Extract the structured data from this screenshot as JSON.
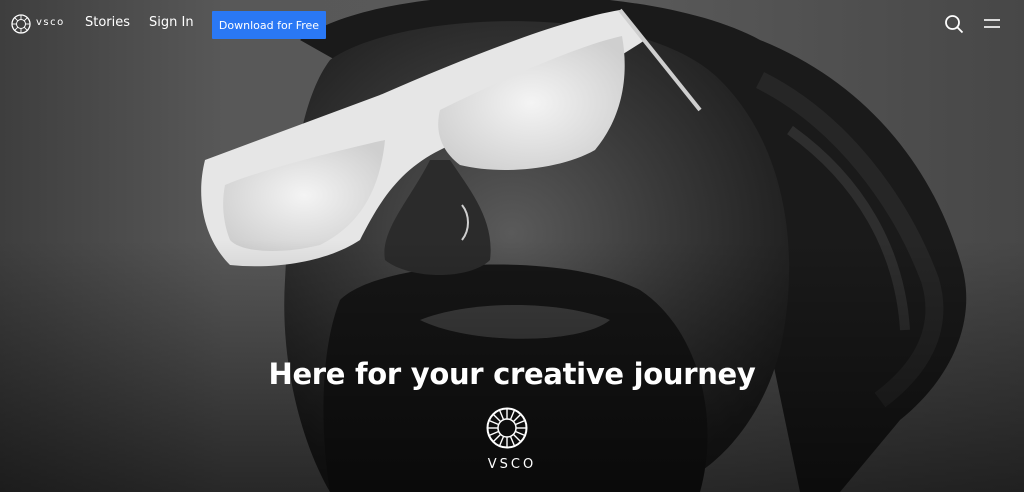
{
  "nav": {
    "brand": "vsco",
    "links": [
      "Stories",
      "Sign In"
    ],
    "download_label": "Download for Free"
  },
  "hero": {
    "headline": "Here for your creative journey",
    "brand": "VSCO"
  },
  "icons": {
    "logo": "vsco-logo-icon",
    "search": "search-icon",
    "menu": "menu-icon"
  },
  "colors": {
    "accent": "#2a78f5",
    "text": "#ffffff"
  }
}
